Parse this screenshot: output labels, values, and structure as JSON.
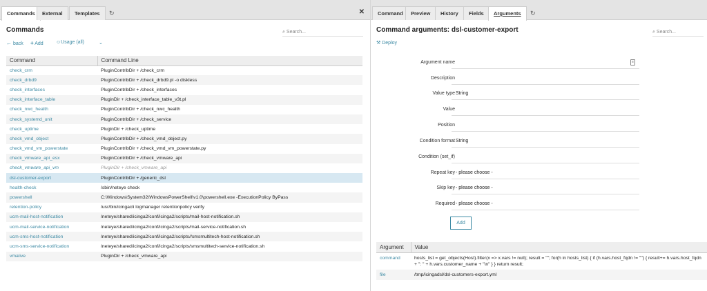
{
  "left": {
    "tabs": [
      "Commands",
      "External",
      "Templates"
    ],
    "refresh_icon": "refresh-icon",
    "close_icon": "close-icon",
    "title": "Commands",
    "search_placeholder": "Search...",
    "actions": {
      "back": "back",
      "add": "Add",
      "usage": "Usage (all)"
    },
    "table": {
      "headers": [
        "Command",
        "Command Line"
      ],
      "rows": [
        [
          "check_crm",
          "PluginContribDir + /check_crm"
        ],
        [
          "check_drbd9",
          "PluginContribDir + /check_drbd9.pl -o diskless"
        ],
        [
          "check_interfaces",
          "PluginContribDir + /check_interfaces"
        ],
        [
          "check_interface_table",
          "PluginDir + /check_interface_table_v3t.pl"
        ],
        [
          "check_nwc_health",
          "PluginContribDir + /check_nwc_health"
        ],
        [
          "check_systemd_unit",
          "PluginContribDir + /check_service"
        ],
        [
          "check_uptime",
          "PluginDir + /check_uptime"
        ],
        [
          "check_vmd_object",
          "PluginContribDir + /check_vmd_object.py"
        ],
        [
          "check_vmd_vm_powerstate",
          "PluginContribDir + /check_vmd_vm_powerstate.py"
        ],
        [
          "check_vmware_api_esx",
          "PluginContribDir + /check_vmware_api"
        ],
        [
          "check_vmware_api_vm",
          "PluginDir + /check_vmware_api"
        ],
        [
          "dsl-customer-export",
          "PluginContribDir + /generic_dsl"
        ],
        [
          "health-check",
          "/sbin/neteye check"
        ],
        [
          "powershell",
          "C:\\Windows\\System32\\WindowsPowerShell\\v1.0\\powershell.exe -ExecutionPolicy ByPass"
        ],
        [
          "retention-policy",
          "/usr/bin/icingacli logmanager retentionpolicy verify"
        ],
        [
          "ucm-mail-host-notification",
          "/neteye/shared/icinga2/conf/icinga2/scripts/mail-host-notification.sh"
        ],
        [
          "ucm-mail-service-notification",
          "/neteye/shared/icinga2/conf/icinga2/scripts/mail-service-notification.sh"
        ],
        [
          "ucm-sms-host-notification",
          "/neteye/shared/icinga2/conf/icinga2/scripts//smsmultitech-host-notification.sh"
        ],
        [
          "ucm-sms-service-notification",
          "/neteye/shared/icinga2/conf/icinga2/scripts/smsmultitech-service-notification.sh"
        ],
        [
          "vmalive",
          "PluginDir + /check_vmware_api"
        ]
      ]
    }
  },
  "right": {
    "tabs": [
      "Command",
      "Preview",
      "History",
      "Fields",
      "Arguments"
    ],
    "refresh_icon": "refresh-icon",
    "title": "Command arguments: dsl-customer-export",
    "search_placeholder": "Search...",
    "deploy": "Deploy",
    "form": [
      {
        "label": "Argument name",
        "value": ""
      },
      {
        "label": "Description",
        "value": ""
      },
      {
        "label": "Value type",
        "value": "String"
      },
      {
        "label": "Value",
        "value": ""
      },
      {
        "label": "Position",
        "value": ""
      },
      {
        "label": "Condition format",
        "value": "String"
      },
      {
        "label": "Condition (set_if)",
        "value": ""
      },
      {
        "label": "Repeat key",
        "value": "- please choose -"
      },
      {
        "label": "Skip key",
        "value": "- please choose -"
      },
      {
        "label": "Required",
        "value": "- please choose -"
      }
    ],
    "add_label": "Add",
    "args_table": {
      "headers": [
        "Argument",
        "Value"
      ],
      "rows": [
        [
          "command",
          "hosts_list = get_objects(Host).filter(x => x.vars != null); result = \"\"; for(h in hosts_list) { if (h.vars.host_fqdn != \"\") { result+= h.vars.host_fqdn + \": \" + h.vars.customer_name + \"\\n\" } } return result;"
        ],
        [
          "file",
          "/tmp/icingadsl/dsl-customers-export.yml"
        ]
      ]
    }
  }
}
